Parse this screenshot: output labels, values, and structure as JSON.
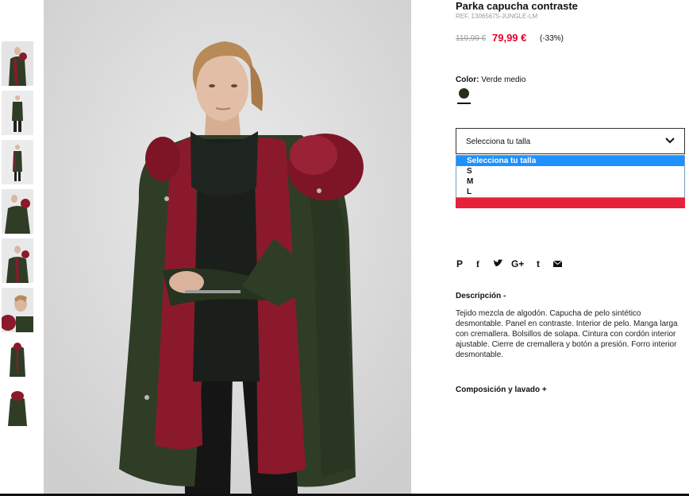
{
  "product": {
    "title": "Parka capucha contraste",
    "ref": "REF. 13065675-JUNGLE-LM",
    "old_price": "119,99 €",
    "price": "79,99 €",
    "discount": "(-33%)"
  },
  "color": {
    "label": "Color:",
    "value": "Verde medio",
    "swatch_hex": "#23301e"
  },
  "size_select": {
    "value": "Selecciona tu talla",
    "options": [
      "Selecciona tu talla",
      "S",
      "M",
      "L"
    ],
    "selected_index": 0
  },
  "social": {
    "icons": [
      "pinterest-icon",
      "facebook-icon",
      "twitter-icon",
      "google-plus-icon",
      "tumblr-icon",
      "email-icon"
    ],
    "labels": {
      "pinterest": "P",
      "facebook": "f",
      "google": "G+",
      "tumblr": "t"
    }
  },
  "description": {
    "title": "Descripción -",
    "text": "Tejido mezcla de algodón. Capucha de pelo sintético desmontable. Panel en contraste. Interior de pelo. Manga larga con cremallera. Bolsillos de solapa. Cintura con cordón interior ajustable. Cierre de cremallera y botón a presión. Forro interior desmontable."
  },
  "composition": {
    "title": "Composición y lavado +"
  },
  "colors": {
    "accent_red": "#e4002b",
    "select_highlight": "#1e90ff",
    "parka_green": "#2f3d27",
    "fur_burgundy": "#8a1a2b"
  }
}
